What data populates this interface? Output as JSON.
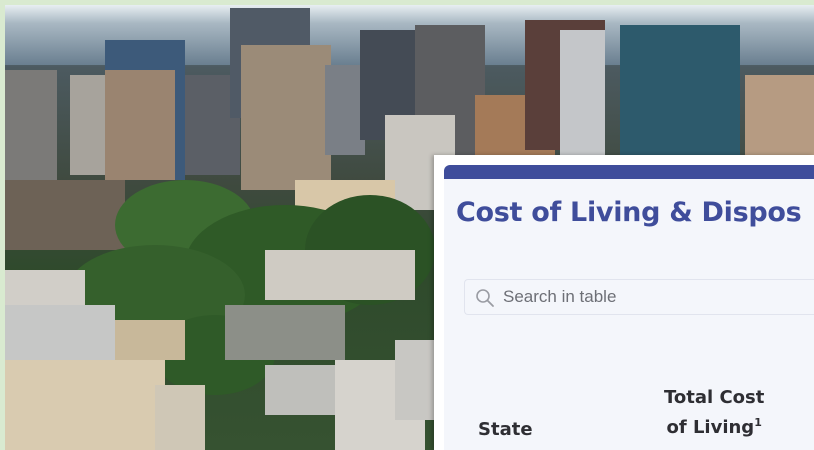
{
  "card": {
    "title": "Cost of Living & Dispos",
    "search": {
      "placeholder": "Search in table"
    },
    "columns": {
      "state": "State",
      "total_cost_line1": "Total Cost",
      "total_cost_line2": "of Living",
      "total_cost_footnote": "1"
    }
  },
  "colors": {
    "accent": "#3f4d9b",
    "background": "#d9ead0"
  },
  "icons": {
    "search": "search-icon"
  }
}
